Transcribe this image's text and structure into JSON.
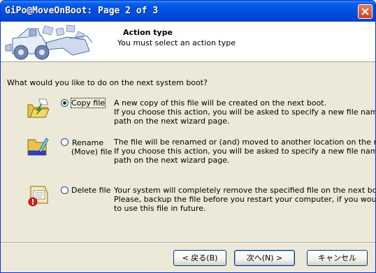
{
  "window": {
    "title": "GiPo@MoveOnBoot: Page 2 of 3"
  },
  "header": {
    "title": "Action type",
    "subtitle": "You must select an action type"
  },
  "question": "What would you like to do on the next system boot?",
  "options": [
    {
      "label": "Copy file",
      "checked": true,
      "icon": "copy-file-icon",
      "desc": [
        "A new copy of this file will be created on the next boot.",
        "If you choose this action, you will be asked to specify a new file name and",
        "path on the next wizard page."
      ]
    },
    {
      "label_line1": "Rename",
      "label_line2": "(Move) file",
      "checked": false,
      "icon": "rename-file-icon",
      "desc": [
        "The file will be renamed or (and) moved to another location on the next boot.",
        "If you choose this action, you will be asked to specify a new file name and",
        "path on the next wizard page."
      ]
    },
    {
      "label": "Delete file",
      "checked": false,
      "icon": "delete-file-icon",
      "desc": [
        "Your system will completely remove the specified file on the next boot.",
        "Please, backup the file before you restart your computer, if you would like",
        "to use this file in future."
      ]
    }
  ],
  "buttons": {
    "back": "< 戻る(B)",
    "next": "次へ(N) >",
    "cancel": "キャンセル"
  },
  "colors": {
    "titlebar": "#0054e3",
    "dialog": "#ece9d8",
    "close": "#c8412a"
  }
}
